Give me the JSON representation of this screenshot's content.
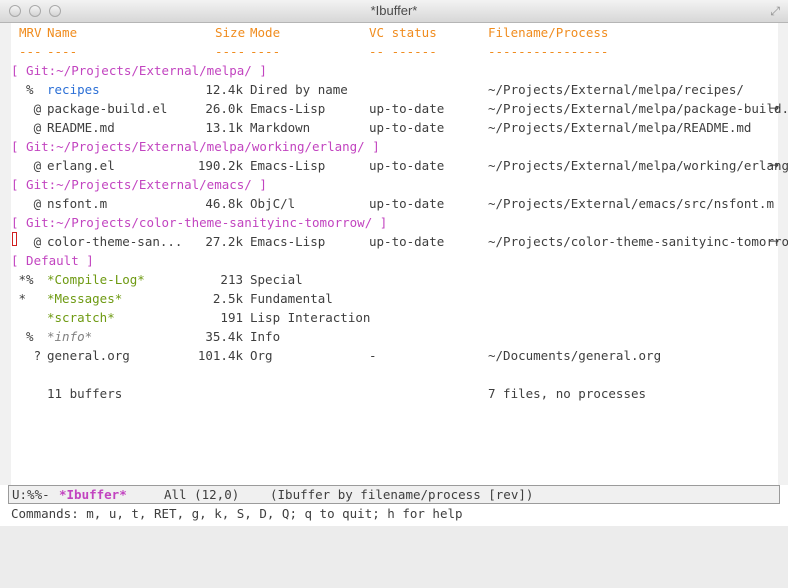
{
  "window": {
    "title": "*Ibuffer*"
  },
  "header": {
    "mrv": "MRV",
    "name": "Name",
    "size": "Size",
    "mode": "Mode",
    "vc": "VC status",
    "file": "Filename/Process",
    "u_mrv": "---",
    "u_name": "----",
    "u_size": "----",
    "u_mode": "----",
    "u_vc": "-- ------",
    "u_file": "----------------"
  },
  "rows": [
    {
      "type": "group",
      "text": "[ Git:~/Projects/External/melpa/ ]"
    },
    {
      "type": "buf",
      "mark": "  %",
      "name": "recipes",
      "name_style": "blue",
      "size": "12.4k",
      "mode": "Dired by name",
      "vc": "",
      "file": "~/Projects/External/melpa/recipes/"
    },
    {
      "type": "buf",
      "mark": "   @",
      "name": "package-build.el",
      "size": "26.0k",
      "mode": "Emacs-Lisp",
      "vc": "up-to-date",
      "file": "~/Projects/External/melpa/package-build.e",
      "more": "→"
    },
    {
      "type": "buf",
      "mark": "   @",
      "name": "README.md",
      "size": "13.1k",
      "mode": "Markdown",
      "vc": "up-to-date",
      "file": "~/Projects/External/melpa/README.md"
    },
    {
      "type": "group",
      "text": "[ Git:~/Projects/External/melpa/working/erlang/ ]"
    },
    {
      "type": "buf",
      "mark": "   @",
      "name": "erlang.el",
      "size": "190.2k",
      "mode": "Emacs-Lisp",
      "vc": "up-to-date",
      "file": "~/Projects/External/melpa/working/erlang/",
      "more": "→"
    },
    {
      "type": "group",
      "text": "[ Git:~/Projects/External/emacs/ ]"
    },
    {
      "type": "buf",
      "mark": "   @",
      "name": "nsfont.m",
      "size": "46.8k",
      "mode": "ObjC/l",
      "vc": "up-to-date",
      "file": "~/Projects/External/emacs/src/nsfont.m"
    },
    {
      "type": "group",
      "text": "[ Git:~/Projects/color-theme-sanityinc-tomorrow/ ]"
    },
    {
      "type": "buf",
      "mark": "   @",
      "name": "color-theme-san...",
      "size": "27.2k",
      "mode": "Emacs-Lisp",
      "vc": "up-to-date",
      "file": "~/Projects/color-theme-sanityinc-tomorrow",
      "more": "→",
      "cursor": true
    },
    {
      "type": "group",
      "text": "[ Default ]"
    },
    {
      "type": "buf",
      "mark": " *%",
      "name": "*Compile-Log*",
      "name_style": "green",
      "size": "213",
      "mode": "Special",
      "vc": "",
      "file": ""
    },
    {
      "type": "buf",
      "mark": " *",
      "name": "*Messages*",
      "name_style": "green",
      "size": "2.5k",
      "mode": "Fundamental",
      "vc": "",
      "file": ""
    },
    {
      "type": "buf",
      "mark": "",
      "name": "*scratch*",
      "name_style": "green",
      "size": "191",
      "mode": "Lisp Interaction",
      "vc": "",
      "file": ""
    },
    {
      "type": "buf",
      "mark": "  %",
      "name": "*info*",
      "name_style": "grey-it",
      "size": "35.4k",
      "mode": "Info",
      "vc": "",
      "file": ""
    },
    {
      "type": "buf",
      "mark": "   ?",
      "name": "general.org",
      "size": "101.4k",
      "mode": "Org",
      "vc": "-",
      "file": "~/Documents/general.org"
    },
    {
      "type": "blank"
    },
    {
      "type": "summary",
      "left": "11 buffers",
      "right": "7 files, no processes"
    }
  ],
  "modeline": {
    "status": "U:%%-",
    "buffer": "*Ibuffer*",
    "position": "All (12,0)",
    "modes": "(Ibuffer by filename/process [rev])"
  },
  "echo": "Commands: m, u, t, RET, g, k, S, D, Q; q to quit; h for help",
  "colors": {
    "header": "#f08c1e",
    "group": "#c244c0",
    "dired": "#2b6fd6",
    "special": "#6e9a12",
    "text": "#3e3e3e"
  },
  "icons": [
    "close-traffic-light",
    "minimize-traffic-light",
    "zoom-traffic-light",
    "fullscreen-icon",
    "continuation-arrow-icon"
  ]
}
